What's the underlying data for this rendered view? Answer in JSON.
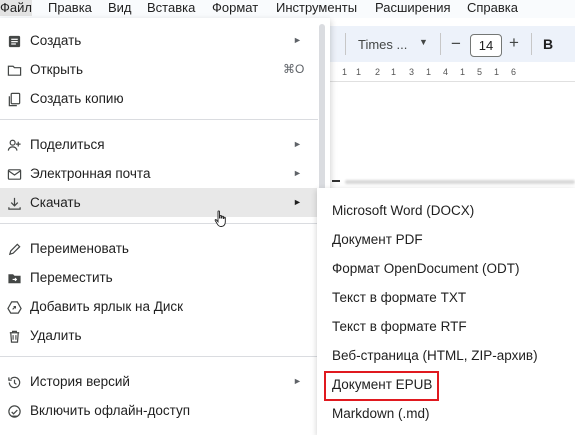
{
  "menubar": {
    "items": [
      "Файл",
      "Правка",
      "Вид",
      "Вставка",
      "Формат",
      "Инструменты",
      "Расширения",
      "Справка"
    ]
  },
  "toolbar": {
    "font_name": "Times ...",
    "font_size": "14",
    "bold_label": "B"
  },
  "ruler": {
    "ticks": [
      "1",
      "1",
      "2",
      "1",
      "3",
      "1",
      "4",
      "1",
      "5",
      "1",
      "6"
    ]
  },
  "file_menu": {
    "items": [
      {
        "label": "Создать",
        "icon": "document-icon",
        "has_submenu": true
      },
      {
        "label": "Открыть",
        "icon": "folder-icon",
        "shortcut": "⌘O"
      },
      {
        "label": "Создать копию",
        "icon": "copy-icon"
      },
      {
        "label": "Поделиться",
        "icon": "person-add-icon",
        "has_submenu": true
      },
      {
        "label": "Электронная почта",
        "icon": "mail-icon",
        "has_submenu": true
      },
      {
        "label": "Скачать",
        "icon": "download-icon",
        "has_submenu": true,
        "hovered": true
      },
      {
        "label": "Переименовать",
        "icon": "pencil-icon"
      },
      {
        "label": "Переместить",
        "icon": "move-folder-icon"
      },
      {
        "label": "Добавить ярлык на Диск",
        "icon": "drive-shortcut-icon"
      },
      {
        "label": "Удалить",
        "icon": "trash-icon"
      },
      {
        "label": "История версий",
        "icon": "history-icon",
        "has_submenu": true
      },
      {
        "label": "Включить офлайн-доступ",
        "icon": "offline-check-icon"
      }
    ]
  },
  "download_submenu": {
    "items": [
      "Microsoft Word (DOCX)",
      "Документ PDF",
      "Формат OpenDocument (ODT)",
      "Текст в формате TXT",
      "Текст в формате RTF",
      "Веб-страница (HTML, ZIP-архив)",
      "Документ EPUB",
      "Markdown (.md)"
    ],
    "highlighted_item": "Документ EPUB",
    "highlight_color": "#e0191f"
  },
  "colors": {
    "hover_bg": "#e8e8e8",
    "toolbar_bg": "#edf2fa"
  }
}
